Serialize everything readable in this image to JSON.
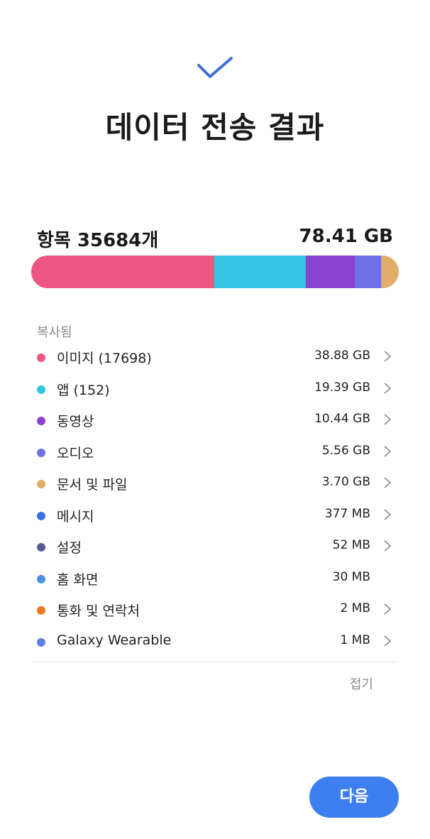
{
  "header": {
    "title": "데이터 전송 결과",
    "icon": "checkmark-icon"
  },
  "summary": {
    "items_label": "항목 35684개",
    "total_size": "78.41 GB"
  },
  "usage_bar": [
    {
      "category": "이미지",
      "size_gb": 38.88,
      "color": "#ec5680"
    },
    {
      "category": "앱",
      "size_gb": 19.39,
      "color": "#33c4e6"
    },
    {
      "category": "동영상",
      "size_gb": 10.44,
      "color": "#8a42cf"
    },
    {
      "category": "오디오",
      "size_gb": 5.56,
      "color": "#6f72e4"
    },
    {
      "category": "문서 및 파일",
      "size_gb": 3.7,
      "color": "#e2ad6a"
    }
  ],
  "section_label": "복사됨",
  "items": [
    {
      "name": "이미지 (17698)",
      "size": "38.88 GB",
      "color": "#ec5680",
      "icon": "chevron-right-icon"
    },
    {
      "name": "앱 (152)",
      "size": "19.39 GB",
      "color": "#33c4e6",
      "icon": "chevron-right-icon"
    },
    {
      "name": "동영상",
      "size": "10.44 GB",
      "color": "#8a42cf",
      "icon": "chevron-right-icon"
    },
    {
      "name": "오디오",
      "size": "5.56 GB",
      "color": "#6f72e4",
      "icon": "chevron-right-icon"
    },
    {
      "name": "문서 및 파일",
      "size": "3.70 GB",
      "color": "#e2ad6a",
      "icon": "chevron-right-icon"
    },
    {
      "name": "메시지",
      "size": "377 MB",
      "color": "#3d6fe6",
      "icon": "chevron-right-icon"
    },
    {
      "name": "설정",
      "size": "52 MB",
      "color": "#5a5a92",
      "icon": "chevron-right-icon"
    },
    {
      "name": "홈 화면",
      "size": "30 MB",
      "color": "#4a8fe0",
      "icon": ""
    },
    {
      "name": "통화 및 연락처",
      "size": "2 MB",
      "color": "#ea7a22",
      "icon": "chevron-right-icon"
    },
    {
      "name": "Galaxy Wearable",
      "size": "1 MB",
      "color": "#5c7fe8",
      "icon": "chevron-right-icon"
    }
  ],
  "collapse_label": "접기",
  "next_button": {
    "label": "다음",
    "color": "#3d7ef0"
  }
}
